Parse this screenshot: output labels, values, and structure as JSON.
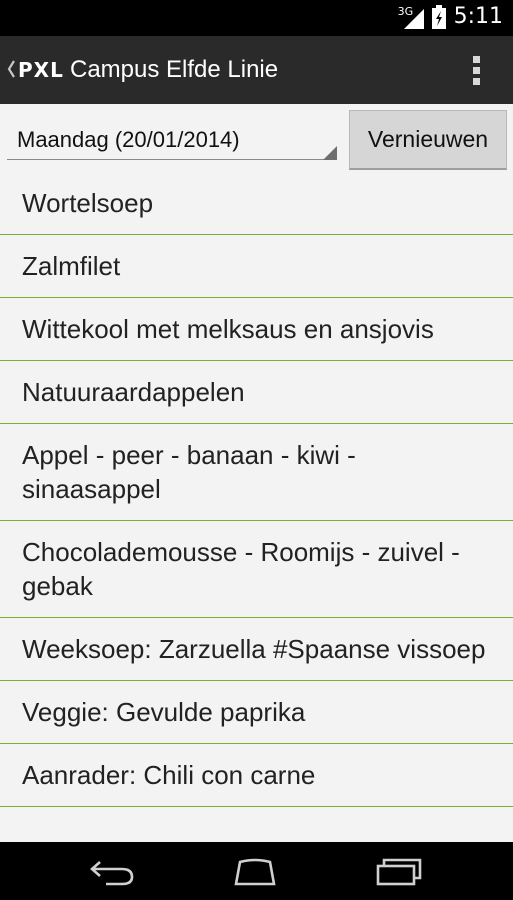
{
  "status_bar": {
    "network_type": "3G",
    "time": "5:11",
    "signal_icon": "signal-icon",
    "battery_icon": "battery-icon"
  },
  "action_bar": {
    "logo": "PXL",
    "title": "Campus Elfde Linie",
    "up_icon": "up-caret-icon",
    "overflow_icon": "overflow-menu-icon"
  },
  "selector": {
    "selected_day": "Maandag (20/01/2014)",
    "refresh_label": "Vernieuwen"
  },
  "menu_items": [
    {
      "label": "Wortelsoep"
    },
    {
      "label": "Zalmfilet"
    },
    {
      "label": "Wittekool met melksaus en ansjovis"
    },
    {
      "label": "Natuuraardappelen"
    },
    {
      "label": "Appel - peer - banaan - kiwi - sinaasappel"
    },
    {
      "label": "Chocolademousse - Roomijs - zuivel - gebak"
    },
    {
      "label": "Weeksoep: Zarzuella #Spaanse vissoep"
    },
    {
      "label": "Veggie: Gevulde paprika"
    },
    {
      "label": "Aanrader: Chili con carne"
    }
  ],
  "colors": {
    "divider": "#79ae3a",
    "action_bar": "#2a2a2a",
    "background": "#f3f3f3"
  },
  "nav_bar": {
    "back_icon": "back-icon",
    "home_icon": "home-icon",
    "recents_icon": "recents-icon"
  }
}
